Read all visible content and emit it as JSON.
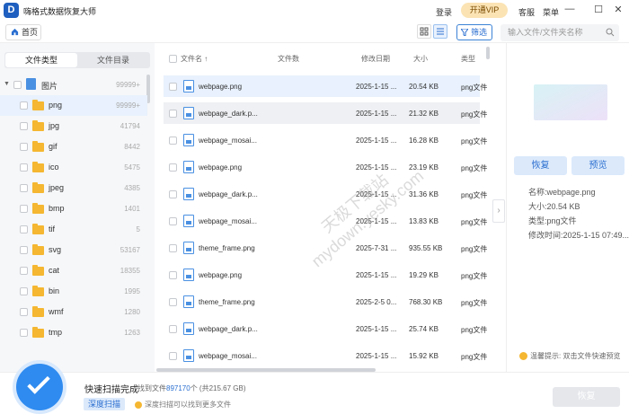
{
  "app": {
    "title": "嗨格式数据恢复大师",
    "logo_letter": "D"
  },
  "titlebar": {
    "login": "登录",
    "vip": "开通VIP",
    "service": "客服",
    "menu": "菜单"
  },
  "toolbar": {
    "home": "首页",
    "filter": "筛选",
    "search_placeholder": "输入文件/文件夹名称"
  },
  "left": {
    "tabs": [
      "文件类型",
      "文件目录"
    ],
    "root": {
      "label": "图片",
      "count": "99999+"
    },
    "items": [
      {
        "label": "png",
        "count": "99999+"
      },
      {
        "label": "jpg",
        "count": "41794"
      },
      {
        "label": "gif",
        "count": "8442"
      },
      {
        "label": "ico",
        "count": "5475"
      },
      {
        "label": "jpeg",
        "count": "4385"
      },
      {
        "label": "bmp",
        "count": "1401"
      },
      {
        "label": "tif",
        "count": "5"
      },
      {
        "label": "svg",
        "count": "53167"
      },
      {
        "label": "cat",
        "count": "18355"
      },
      {
        "label": "bin",
        "count": "1995"
      },
      {
        "label": "wmf",
        "count": "1280"
      },
      {
        "label": "tmp",
        "count": "1263"
      }
    ]
  },
  "table": {
    "headers": {
      "name": "文件名 ↑",
      "count": "文件数",
      "date": "修改日期",
      "size": "大小",
      "type": "类型"
    },
    "rows": [
      {
        "name": "webpage.png",
        "date": "2025-1-15 ...",
        "size": "20.54 KB",
        "type": "png文件"
      },
      {
        "name": "webpage_dark.p...",
        "date": "2025-1-15 ...",
        "size": "21.32 KB",
        "type": "png文件"
      },
      {
        "name": "webpage_mosai...",
        "date": "2025-1-15 ...",
        "size": "16.28 KB",
        "type": "png文件"
      },
      {
        "name": "webpage.png",
        "date": "2025-1-15 ...",
        "size": "23.19 KB",
        "type": "png文件"
      },
      {
        "name": "webpage_dark.p...",
        "date": "2025-1-15 ...",
        "size": "31.36 KB",
        "type": "png文件"
      },
      {
        "name": "webpage_mosai...",
        "date": "2025-1-15 ...",
        "size": "13.83 KB",
        "type": "png文件"
      },
      {
        "name": "theme_frame.png",
        "date": "2025-7-31 ...",
        "size": "935.55 KB",
        "type": "png文件"
      },
      {
        "name": "webpage.png",
        "date": "2025-1-15 ...",
        "size": "19.29 KB",
        "type": "png文件"
      },
      {
        "name": "theme_frame.png",
        "date": "2025-2-5 0...",
        "size": "768.30 KB",
        "type": "png文件"
      },
      {
        "name": "webpage_dark.p...",
        "date": "2025-1-15 ...",
        "size": "25.74 KB",
        "type": "png文件"
      },
      {
        "name": "webpage_mosai...",
        "date": "2025-1-15 ...",
        "size": "15.92 KB",
        "type": "png文件"
      }
    ]
  },
  "watermark": {
    "line1": "天极下载站",
    "line2": "mydown.yesky.com"
  },
  "preview": {
    "recover": "恢复",
    "preview": "预览",
    "name": "名称:webpage.png",
    "size": "大小:20.54 KB",
    "type": "类型:png文件",
    "mtime": "修改时间:2025-1-15 07:49...",
    "tip": "温馨提示:  双击文件快速预览"
  },
  "bottom": {
    "title": "快速扫描完成",
    "found_prefix": "找到文件",
    "found_count": "897170",
    "found_suffix": "个  (共215.67 GB)",
    "deep_scan": "深度扫描",
    "deep_tip": "深度扫描可以找到更多文件",
    "recover": "恢复"
  }
}
